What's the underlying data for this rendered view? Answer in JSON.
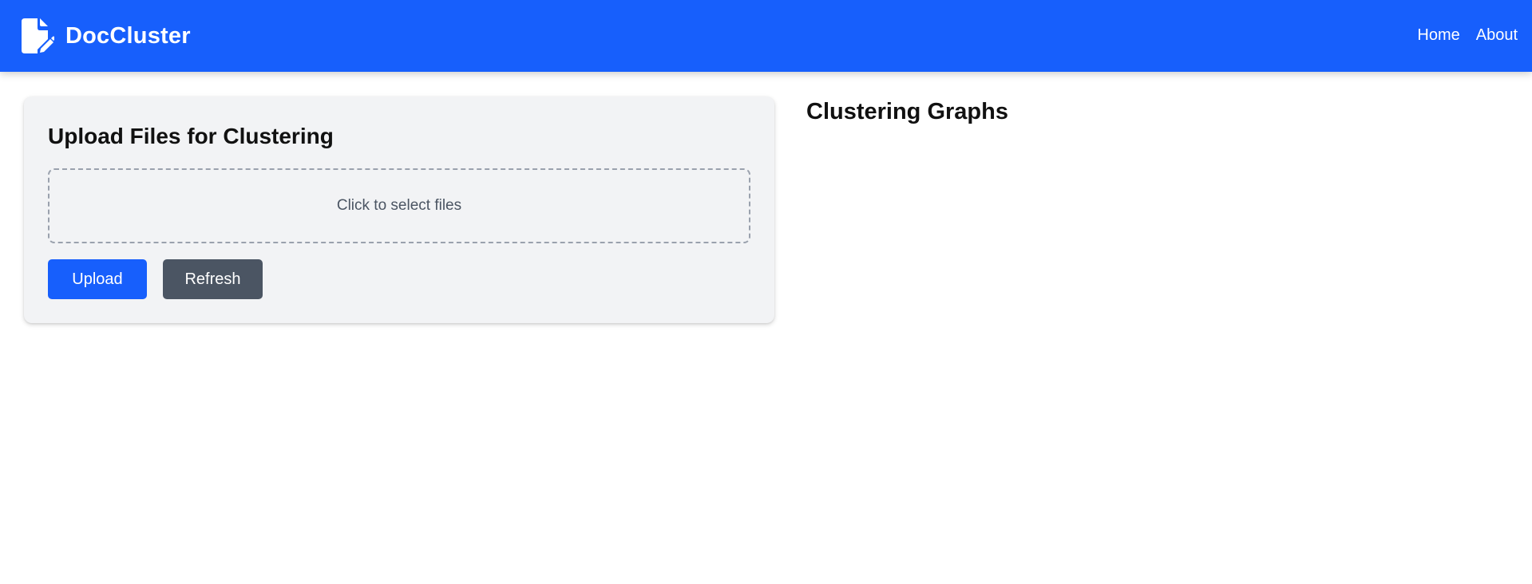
{
  "header": {
    "brand_name": "DocCluster",
    "brand_icon": "document-edit-icon",
    "nav": [
      {
        "label": "Home"
      },
      {
        "label": "About"
      }
    ],
    "colors": {
      "background": "#175ffc",
      "text": "#ffffff"
    }
  },
  "upload_card": {
    "title": "Upload Files for Clustering",
    "dropzone_text": "Click to select files",
    "upload_label": "Upload",
    "refresh_label": "Refresh",
    "colors": {
      "card_background": "#f2f3f5",
      "upload_button": "#175ffc",
      "refresh_button": "#4b5563"
    }
  },
  "graphs": {
    "title": "Clustering Graphs"
  }
}
